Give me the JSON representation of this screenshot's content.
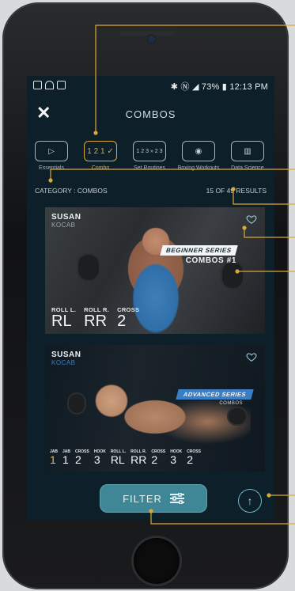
{
  "status": {
    "time": "12:13 PM",
    "battery": "73%"
  },
  "header": {
    "title": "COMBOS"
  },
  "categories": [
    {
      "label": "Essentials",
      "glyph": "▷",
      "active": false
    },
    {
      "label": "Combo",
      "glyph": "1 2 1 ✓",
      "active": true
    },
    {
      "label": "Set Routines",
      "glyph": "1 2 3 » 2 3",
      "active": false
    },
    {
      "label": "Boxing Workouts",
      "glyph": "◉",
      "active": false
    },
    {
      "label": "Data Science",
      "glyph": "▥",
      "active": false
    }
  ],
  "category_bar": {
    "label": "CATEGORY : COMBOS",
    "results": "15 OF 49 RESULTS"
  },
  "cards": [
    {
      "trainer_first": "SUSAN",
      "trainer_last": "KOCAB",
      "series": "BEGINNER SERIES",
      "combo": "COMBOS #1",
      "moves": [
        {
          "label": "ROLL L.",
          "code": "RL"
        },
        {
          "label": "ROLL R.",
          "code": "RR"
        },
        {
          "label": "CROSS",
          "code": "2"
        }
      ]
    },
    {
      "trainer_first": "SUSAN",
      "trainer_last": "KOCAB",
      "series": "ADVANCED SERIES",
      "combo": "COMBOS",
      "moves": [
        {
          "label": "JAB",
          "code": "1"
        },
        {
          "label": "JAB",
          "code": "1"
        },
        {
          "label": "CROSS",
          "code": "2"
        },
        {
          "label": "HOOK",
          "code": "3"
        },
        {
          "label": "ROLL L.",
          "code": "RL"
        },
        {
          "label": "ROLL R.",
          "code": "RR"
        },
        {
          "label": "CROSS",
          "code": "2"
        },
        {
          "label": "HOOK",
          "code": "3"
        },
        {
          "label": "CROSS",
          "code": "2"
        }
      ]
    }
  ],
  "filter": {
    "label": "FILTER"
  },
  "colors": {
    "accent": "#d9a83a",
    "teal": "#3f8696",
    "screen": "#0d1f29",
    "advanced": "#3a7fc6"
  }
}
